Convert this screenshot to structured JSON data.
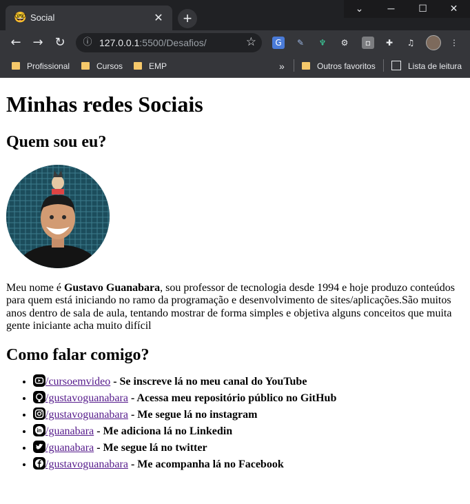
{
  "browser": {
    "tab_title": "Social",
    "tab_icon": "nerd-face-emoji",
    "close_tab_glyph": "✕",
    "new_tab_glyph": "+",
    "url_host": "127.0.0.1",
    "url_rest": ":5500/Desafios/",
    "bookmarks": [
      {
        "label": "Profissional"
      },
      {
        "label": "Cursos"
      },
      {
        "label": "EMP"
      }
    ],
    "overflow_glyph": "»",
    "other_favorites": "Outros favoritos",
    "reading_list": "Lista de leitura"
  },
  "page": {
    "title": "Minhas redes Sociais",
    "about_heading": "Quem sou eu?",
    "bio_intro": "Meu nome é ",
    "bio_name": "Gustavo Guanabara",
    "bio_rest": ", sou professor de tecnologia desde 1994 e hoje produzo conteúdos para quem está iniciando no ramo da programação e desenvolvimento de sites/aplicações.São muitos anos dentro de sala de aula, tentando mostrar de forma simples e objetiva alguns conceitos que muita gente iniciante acha muito difícil",
    "contact_heading": "Como falar comigo?",
    "contacts": [
      {
        "icon": "youtube-icon",
        "link": "/cursoemvideo",
        "text": " - Se inscreve lá no meu canal do YouTube"
      },
      {
        "icon": "github-icon",
        "link": "/gustavoguanabara",
        "text": " - Acessa meu repositório público no GitHub"
      },
      {
        "icon": "instagram-icon",
        "link": "/gustavoguanabara",
        "text": " - Me segue lá no instagram"
      },
      {
        "icon": "linkedin-icon",
        "link": "/guanabara",
        "text": " - Me adiciona lá no Linkedin"
      },
      {
        "icon": "twitter-icon",
        "link": "/guanabara",
        "text": " - Me segue lá no twitter"
      },
      {
        "icon": "facebook-icon",
        "link": "/gustavoguanabara",
        "text": " - Me acompanha lá no Facebook"
      }
    ]
  },
  "colors": {
    "chrome_dark": "#202124",
    "chrome_toolbar": "#35363a",
    "visited_link": "#551a8b"
  }
}
